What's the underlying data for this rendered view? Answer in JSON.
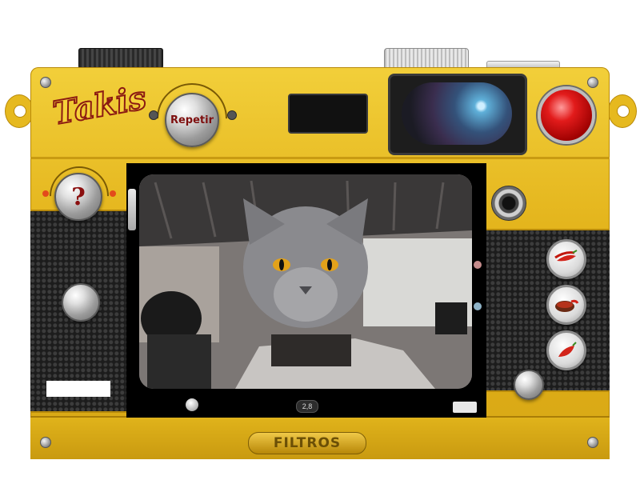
{
  "brand": {
    "logo_text": "Takis"
  },
  "controls": {
    "repetir_label": "Repetir",
    "help_label": "?",
    "filtros_label": "FILTROS",
    "fstop_label": "2,8"
  },
  "filters": [
    {
      "name": "chili-peppers-icon"
    },
    {
      "name": "sauce-bowl-icon"
    },
    {
      "name": "red-pepper-icon"
    }
  ],
  "colors": {
    "body": "#e4b51d",
    "shutter": "#e21b1b",
    "label_red": "#7e0f0f"
  }
}
